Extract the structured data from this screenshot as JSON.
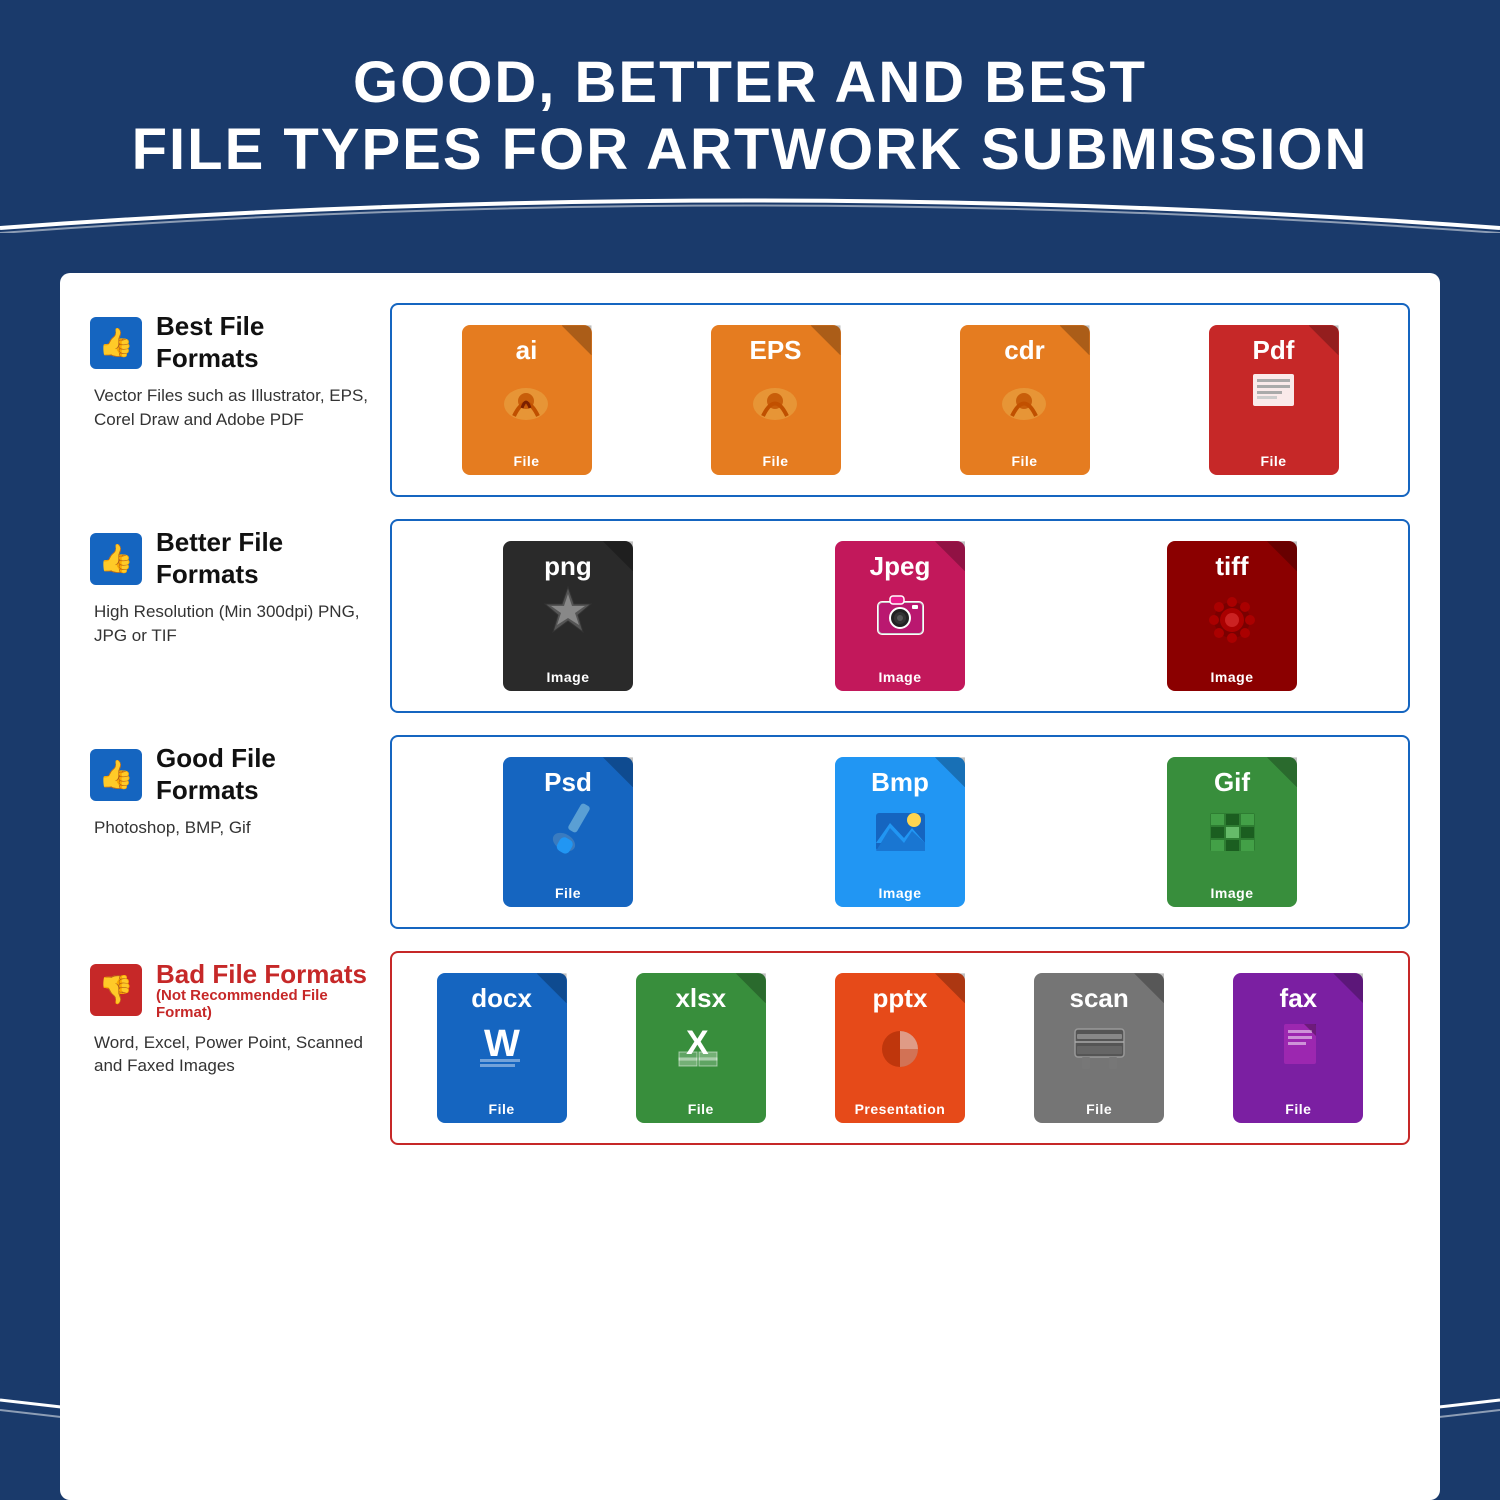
{
  "header": {
    "line1": "GOOD, BETTER AND BEST",
    "line2": "FILE TYPES FOR ARTWORK SUBMISSION"
  },
  "rows": [
    {
      "id": "best",
      "thumbs": "👍",
      "thumbs_type": "good",
      "title": "Best File Formats",
      "subtitle": null,
      "desc": "Vector Files such as Illustrator, EPS, Corel Draw and Adobe PDF",
      "border_type": "good",
      "icons": [
        {
          "ext": "ai",
          "label": "File",
          "color": "orange",
          "icon": "pen"
        },
        {
          "ext": "EPS",
          "label": "File",
          "color": "orange",
          "icon": "pen"
        },
        {
          "ext": "cdr",
          "label": "File",
          "color": "orange",
          "icon": "pen"
        },
        {
          "ext": "Pdf",
          "label": "File",
          "color": "red",
          "icon": "doc"
        }
      ]
    },
    {
      "id": "better",
      "thumbs": "👍",
      "thumbs_type": "good",
      "title": "Better File Formats",
      "subtitle": null,
      "desc": "High Resolution (Min 300dpi) PNG, JPG or TIF",
      "border_type": "good",
      "icons": [
        {
          "ext": "png",
          "label": "Image",
          "color": "black",
          "icon": "gear"
        },
        {
          "ext": "Jpeg",
          "label": "Image",
          "color": "pink",
          "icon": "camera"
        },
        {
          "ext": "tiff",
          "label": "Image",
          "color": "darkred",
          "icon": "gear2"
        }
      ]
    },
    {
      "id": "good",
      "thumbs": "👍",
      "thumbs_type": "good",
      "title": "Good File Formats",
      "subtitle": null,
      "desc": "Photoshop, BMP, Gif",
      "border_type": "good",
      "icons": [
        {
          "ext": "Psd",
          "label": "File",
          "color": "navy",
          "icon": "brush"
        },
        {
          "ext": "Bmp",
          "label": "Image",
          "color": "blue",
          "icon": "mountain"
        },
        {
          "ext": "Gif",
          "label": "Image",
          "color": "green",
          "icon": "mosaic"
        }
      ]
    },
    {
      "id": "bad",
      "thumbs": "👎",
      "thumbs_type": "bad",
      "title": "Bad File Formats",
      "subtitle": "(Not Recommended File Format)",
      "desc": "Word, Excel, Power Point, Scanned and Faxed Images",
      "border_type": "bad",
      "icons": [
        {
          "ext": "docx",
          "label": "File",
          "color": "word",
          "icon": "word"
        },
        {
          "ext": "xlsx",
          "label": "File",
          "color": "excel",
          "icon": "excel"
        },
        {
          "ext": "pptx",
          "label": "Presentation",
          "color": "ppt",
          "icon": "ppt"
        },
        {
          "ext": "scan",
          "label": "File",
          "color": "gray",
          "icon": "scan"
        },
        {
          "ext": "fax",
          "label": "File",
          "color": "purple",
          "icon": "fax"
        }
      ]
    }
  ]
}
